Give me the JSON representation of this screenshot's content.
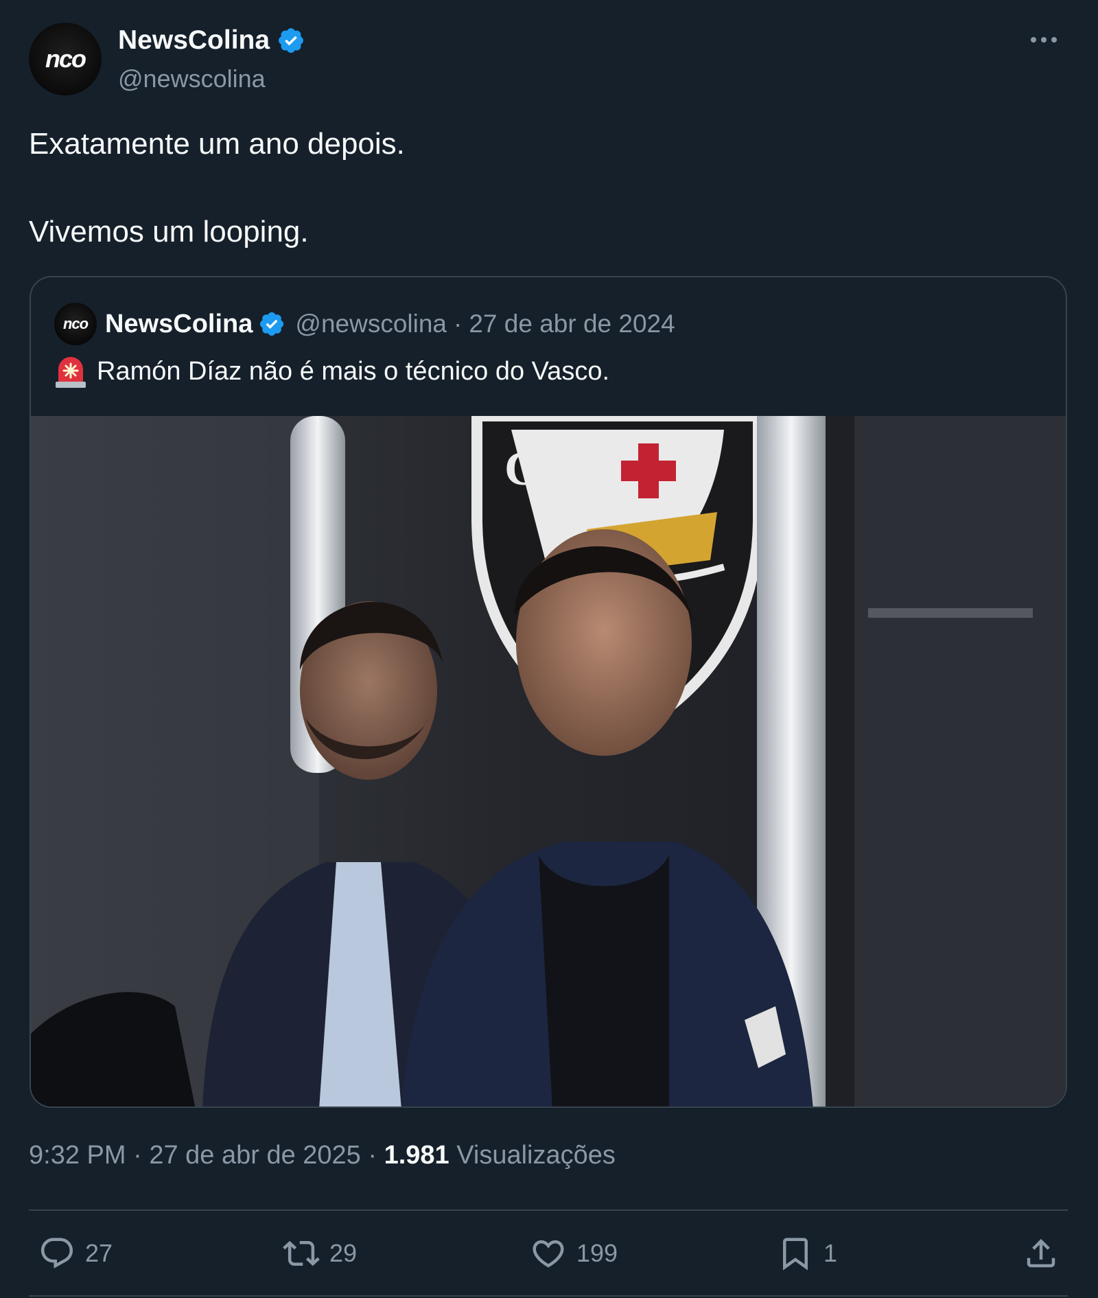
{
  "author": {
    "avatar_text": "nco",
    "display_name": "NewsColina",
    "handle": "@newscolina"
  },
  "tweet": {
    "lines": [
      "Exatamente um ano depois.",
      "Vivemos um looping."
    ]
  },
  "quote": {
    "avatar_text": "nco",
    "display_name": "NewsColina",
    "handle": "@newscolina",
    "separator": "·",
    "date": "27 de abr de 2024",
    "text": "Ramón Díaz não é mais o técnico do Vasco."
  },
  "meta": {
    "time": "9:32 PM",
    "separator": "·",
    "date": "27 de abr de 2025",
    "views_count": "1.981",
    "views_label": "Visualizações"
  },
  "actions": {
    "replies": "27",
    "retweets": "29",
    "likes": "199",
    "bookmarks": "1"
  },
  "colors": {
    "background": "#15202b",
    "verified": "#1d9bf0",
    "secondary_text": "#8b98a5",
    "border": "#38444d"
  }
}
